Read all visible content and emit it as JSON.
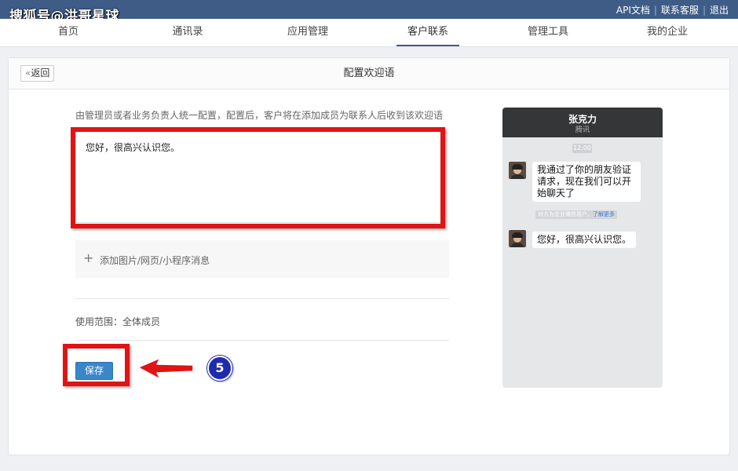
{
  "watermark": "搜狐号@洪哥星球",
  "top_links": {
    "api": "API文档",
    "support": "联系客服",
    "logout": "退出"
  },
  "nav": {
    "tabs": [
      {
        "label": "首页"
      },
      {
        "label": "通讯录"
      },
      {
        "label": "应用管理"
      },
      {
        "label": "客户联系",
        "active": true
      },
      {
        "label": "管理工具"
      },
      {
        "label": "我的企业"
      }
    ]
  },
  "panel": {
    "back_label": "返回",
    "title": "配置欢迎语",
    "description": "由管理员或者业务负责人统一配置，配置后，客户将在添加成员为联系人后收到该欢迎语",
    "welcome_text": "您好，很高兴认识您。",
    "attach_label": "添加图片/网页/小程序消息",
    "scope_label": "使用范围：全体成员",
    "save_label": "保存",
    "step_number": "5"
  },
  "phone_preview": {
    "contact_name": "张克力",
    "contact_company": "腾讯",
    "time": "12:00",
    "messages": [
      {
        "text_lines": [
          "我通过了你的朋友验证",
          "请求，现在我们可以开",
          "始聊天了"
        ]
      },
      {
        "text_lines": [
          "您好，很高兴认识您。"
        ]
      }
    ],
    "notice_text": "对方为企业微信用户，",
    "notice_link": "了解更多"
  },
  "colors": {
    "topbar": "#3e5c86",
    "annotation_red": "#e01414",
    "save_button": "#3a86c8",
    "step_badge": "#1e2bb0"
  },
  "icons": [
    "back-chevron-icon",
    "plus-icon",
    "red-arrow-icon",
    "avatar-icon"
  ]
}
